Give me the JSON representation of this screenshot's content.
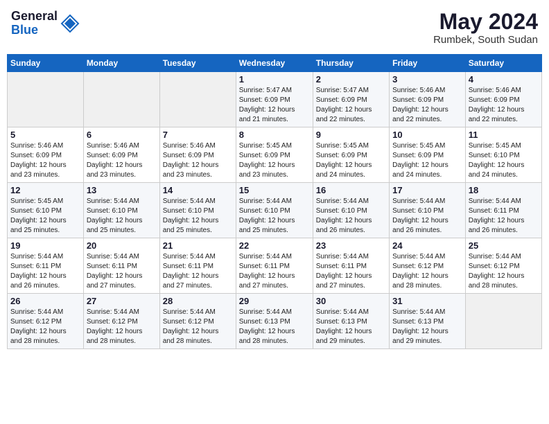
{
  "header": {
    "logo_line1": "General",
    "logo_line2": "Blue",
    "month_title": "May 2024",
    "location": "Rumbek, South Sudan"
  },
  "weekdays": [
    "Sunday",
    "Monday",
    "Tuesday",
    "Wednesday",
    "Thursday",
    "Friday",
    "Saturday"
  ],
  "weeks": [
    [
      {
        "day": "",
        "info": ""
      },
      {
        "day": "",
        "info": ""
      },
      {
        "day": "",
        "info": ""
      },
      {
        "day": "1",
        "info": "Sunrise: 5:47 AM\nSunset: 6:09 PM\nDaylight: 12 hours\nand 21 minutes."
      },
      {
        "day": "2",
        "info": "Sunrise: 5:47 AM\nSunset: 6:09 PM\nDaylight: 12 hours\nand 22 minutes."
      },
      {
        "day": "3",
        "info": "Sunrise: 5:46 AM\nSunset: 6:09 PM\nDaylight: 12 hours\nand 22 minutes."
      },
      {
        "day": "4",
        "info": "Sunrise: 5:46 AM\nSunset: 6:09 PM\nDaylight: 12 hours\nand 22 minutes."
      }
    ],
    [
      {
        "day": "5",
        "info": "Sunrise: 5:46 AM\nSunset: 6:09 PM\nDaylight: 12 hours\nand 23 minutes."
      },
      {
        "day": "6",
        "info": "Sunrise: 5:46 AM\nSunset: 6:09 PM\nDaylight: 12 hours\nand 23 minutes."
      },
      {
        "day": "7",
        "info": "Sunrise: 5:46 AM\nSunset: 6:09 PM\nDaylight: 12 hours\nand 23 minutes."
      },
      {
        "day": "8",
        "info": "Sunrise: 5:45 AM\nSunset: 6:09 PM\nDaylight: 12 hours\nand 23 minutes."
      },
      {
        "day": "9",
        "info": "Sunrise: 5:45 AM\nSunset: 6:09 PM\nDaylight: 12 hours\nand 24 minutes."
      },
      {
        "day": "10",
        "info": "Sunrise: 5:45 AM\nSunset: 6:09 PM\nDaylight: 12 hours\nand 24 minutes."
      },
      {
        "day": "11",
        "info": "Sunrise: 5:45 AM\nSunset: 6:10 PM\nDaylight: 12 hours\nand 24 minutes."
      }
    ],
    [
      {
        "day": "12",
        "info": "Sunrise: 5:45 AM\nSunset: 6:10 PM\nDaylight: 12 hours\nand 25 minutes."
      },
      {
        "day": "13",
        "info": "Sunrise: 5:44 AM\nSunset: 6:10 PM\nDaylight: 12 hours\nand 25 minutes."
      },
      {
        "day": "14",
        "info": "Sunrise: 5:44 AM\nSunset: 6:10 PM\nDaylight: 12 hours\nand 25 minutes."
      },
      {
        "day": "15",
        "info": "Sunrise: 5:44 AM\nSunset: 6:10 PM\nDaylight: 12 hours\nand 25 minutes."
      },
      {
        "day": "16",
        "info": "Sunrise: 5:44 AM\nSunset: 6:10 PM\nDaylight: 12 hours\nand 26 minutes."
      },
      {
        "day": "17",
        "info": "Sunrise: 5:44 AM\nSunset: 6:10 PM\nDaylight: 12 hours\nand 26 minutes."
      },
      {
        "day": "18",
        "info": "Sunrise: 5:44 AM\nSunset: 6:11 PM\nDaylight: 12 hours\nand 26 minutes."
      }
    ],
    [
      {
        "day": "19",
        "info": "Sunrise: 5:44 AM\nSunset: 6:11 PM\nDaylight: 12 hours\nand 26 minutes."
      },
      {
        "day": "20",
        "info": "Sunrise: 5:44 AM\nSunset: 6:11 PM\nDaylight: 12 hours\nand 27 minutes."
      },
      {
        "day": "21",
        "info": "Sunrise: 5:44 AM\nSunset: 6:11 PM\nDaylight: 12 hours\nand 27 minutes."
      },
      {
        "day": "22",
        "info": "Sunrise: 5:44 AM\nSunset: 6:11 PM\nDaylight: 12 hours\nand 27 minutes."
      },
      {
        "day": "23",
        "info": "Sunrise: 5:44 AM\nSunset: 6:11 PM\nDaylight: 12 hours\nand 27 minutes."
      },
      {
        "day": "24",
        "info": "Sunrise: 5:44 AM\nSunset: 6:12 PM\nDaylight: 12 hours\nand 28 minutes."
      },
      {
        "day": "25",
        "info": "Sunrise: 5:44 AM\nSunset: 6:12 PM\nDaylight: 12 hours\nand 28 minutes."
      }
    ],
    [
      {
        "day": "26",
        "info": "Sunrise: 5:44 AM\nSunset: 6:12 PM\nDaylight: 12 hours\nand 28 minutes."
      },
      {
        "day": "27",
        "info": "Sunrise: 5:44 AM\nSunset: 6:12 PM\nDaylight: 12 hours\nand 28 minutes."
      },
      {
        "day": "28",
        "info": "Sunrise: 5:44 AM\nSunset: 6:12 PM\nDaylight: 12 hours\nand 28 minutes."
      },
      {
        "day": "29",
        "info": "Sunrise: 5:44 AM\nSunset: 6:13 PM\nDaylight: 12 hours\nand 28 minutes."
      },
      {
        "day": "30",
        "info": "Sunrise: 5:44 AM\nSunset: 6:13 PM\nDaylight: 12 hours\nand 29 minutes."
      },
      {
        "day": "31",
        "info": "Sunrise: 5:44 AM\nSunset: 6:13 PM\nDaylight: 12 hours\nand 29 minutes."
      },
      {
        "day": "",
        "info": ""
      }
    ]
  ]
}
